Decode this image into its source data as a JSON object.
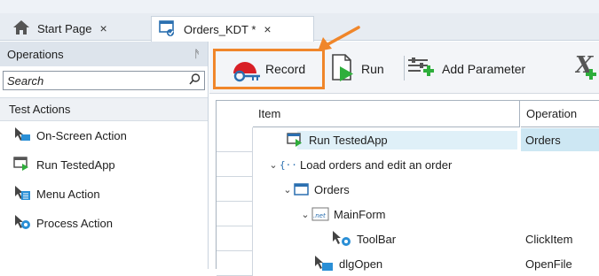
{
  "tabs": [
    {
      "label": "Start Page",
      "close": "×"
    },
    {
      "label": "Orders_KDT *",
      "close": "×"
    }
  ],
  "left_panel": {
    "title": "Operations",
    "pin": "ᚫ",
    "search_placeholder": "Search",
    "section": "Test Actions",
    "items": [
      {
        "label": "On-Screen Action"
      },
      {
        "label": "Run TestedApp"
      },
      {
        "label": "Menu Action"
      },
      {
        "label": "Process Action"
      }
    ]
  },
  "toolbar": {
    "record_label": "Record",
    "run_label": "Run",
    "add_param_label": "Add Parameter"
  },
  "grid": {
    "col_item": "Item",
    "col_operation": "Operation",
    "rows": [
      {
        "item": "Run TestedApp",
        "operation": "Orders"
      },
      {
        "item": "Load orders and edit an order",
        "operation": ""
      },
      {
        "item": "Orders",
        "operation": ""
      },
      {
        "item": "MainForm",
        "operation": ""
      },
      {
        "item": "ToolBar",
        "operation": "ClickItem"
      },
      {
        "item": "dlgOpen",
        "operation": "OpenFile"
      }
    ]
  },
  "colors": {
    "accent": "#f0862a",
    "record_red": "#d81f26",
    "highlight": "#cde7f3"
  }
}
